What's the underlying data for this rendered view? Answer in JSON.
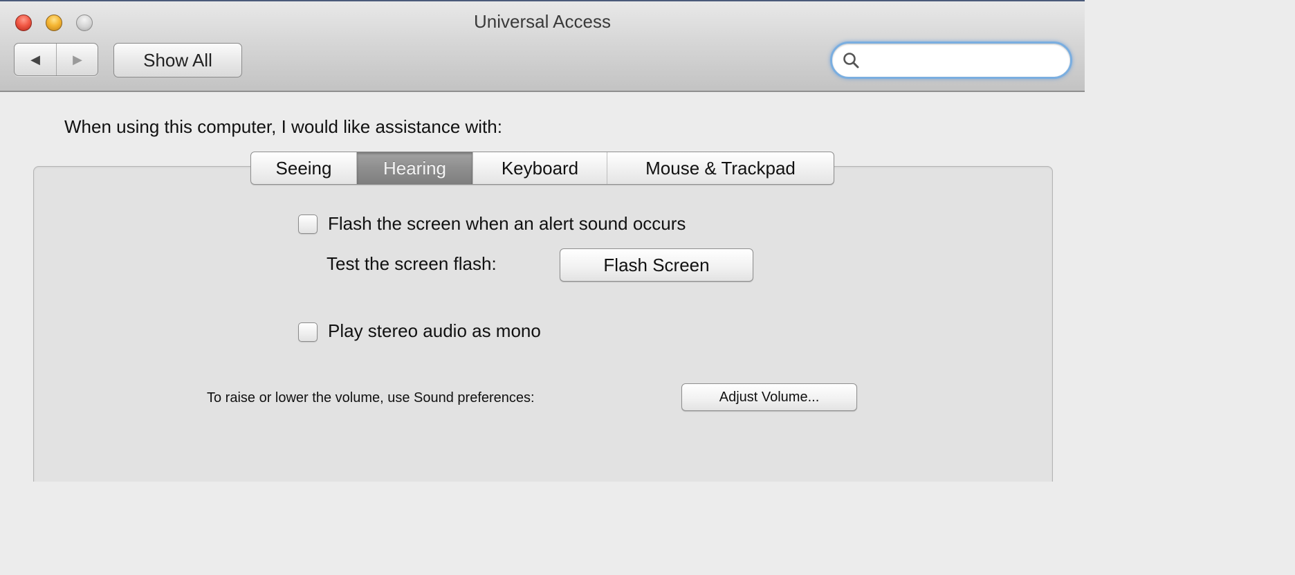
{
  "window": {
    "title": "Universal Access"
  },
  "toolbar": {
    "back_glyph": "◀",
    "forward_glyph": "▶",
    "show_all_label": "Show All",
    "search_value": "",
    "search_placeholder": ""
  },
  "main": {
    "prompt": "When using this computer, I would like assistance with:",
    "tabs": [
      {
        "label": "Seeing",
        "selected": false
      },
      {
        "label": "Hearing",
        "selected": true
      },
      {
        "label": "Keyboard",
        "selected": false
      },
      {
        "label": "Mouse & Trackpad",
        "selected": false
      }
    ],
    "flash_checkbox": {
      "label": "Flash the screen when an alert sound occurs",
      "checked": false
    },
    "test_flash_label": "Test the screen flash:",
    "flash_button_label": "Flash Screen",
    "mono_checkbox": {
      "label": "Play stereo audio as mono",
      "checked": false
    },
    "volume_label": "To raise or lower the volume, use Sound preferences:",
    "adjust_volume_label": "Adjust Volume..."
  },
  "colors": {
    "close": "#f25a47",
    "minimize": "#f5b633",
    "zoom": "#d4d4d4",
    "selected_tab": "#8e8e8e",
    "search_focus_ring": "#7aaee0",
    "window_bg": "#ececec"
  },
  "icons": {
    "search": "magnifier-icon",
    "back": "left-triangle-icon",
    "forward": "right-triangle-icon"
  }
}
